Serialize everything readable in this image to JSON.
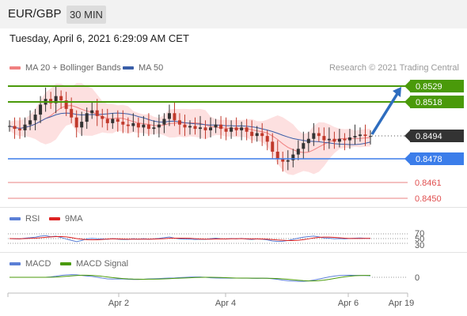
{
  "header": {
    "symbol": "EUR/GBP",
    "timeframe": "30 MIN"
  },
  "timestamp": "Tuesday, April 6, 2021 6:29:09 AM CET",
  "legend": {
    "ma20": "MA 20 + Bollinger Bands",
    "ma50": "MA 50",
    "credit": "Research © 2021 Trading Central",
    "rsi": "RSI",
    "rsi_ma": "9MA",
    "macd": "MACD",
    "macd_signal": "MACD Signal"
  },
  "colors": {
    "ma20": "#f08080",
    "ma50": "#3a5ea8",
    "bands": "#fde0e0",
    "resistance": "#4a9a0a",
    "support": "#3b7dea",
    "pivot_red": "#e05050",
    "current": "#333333",
    "rsi": "#5b7fd6",
    "rsi_ma": "#dd2222",
    "macd": "#5b7fd6",
    "macd_signal": "#4a9a0a",
    "bull": "#333333",
    "bear": "#c0392b"
  },
  "levels": [
    {
      "value": "0.8529",
      "kind": "resistance"
    },
    {
      "value": "0.8518",
      "kind": "resistance"
    },
    {
      "value": "0.8494",
      "kind": "current"
    },
    {
      "value": "0.8478",
      "kind": "support"
    },
    {
      "value": "0.8461",
      "kind": "pivot"
    },
    {
      "value": "0.8450",
      "kind": "pivot"
    }
  ],
  "rsi_levels": [
    "70",
    "50",
    "30"
  ],
  "macd_zero": "0",
  "x_axis": [
    "Apr 2",
    "Apr 4",
    "Apr 6",
    "Apr 19"
  ],
  "chart_data": {
    "type": "candlestick",
    "price_range": [
      0.8445,
      0.8535
    ],
    "closes": [
      0.8501,
      0.8499,
      0.8498,
      0.8502,
      0.8505,
      0.8509,
      0.8516,
      0.852,
      0.8517,
      0.8522,
      0.8519,
      0.8513,
      0.8507,
      0.85,
      0.8504,
      0.851,
      0.8512,
      0.8508,
      0.8506,
      0.8503,
      0.8506,
      0.8504,
      0.8502,
      0.8501,
      0.8503,
      0.85,
      0.8502,
      0.8499,
      0.85,
      0.8502,
      0.8506,
      0.851,
      0.8505,
      0.8502,
      0.85,
      0.8501,
      0.8499,
      0.85,
      0.8498,
      0.85,
      0.8502,
      0.8499,
      0.8497,
      0.85,
      0.8498,
      0.85,
      0.8497,
      0.8494,
      0.8496,
      0.8494,
      0.849,
      0.8483,
      0.8478,
      0.8476,
      0.8477,
      0.8481,
      0.8485,
      0.8489,
      0.8492,
      0.8496,
      0.8494,
      0.8491,
      0.8492,
      0.849,
      0.8492,
      0.8491,
      0.8493,
      0.8494,
      0.8495,
      0.8494,
      0.8494
    ],
    "forecast": [
      0.8494,
      0.8529
    ]
  }
}
